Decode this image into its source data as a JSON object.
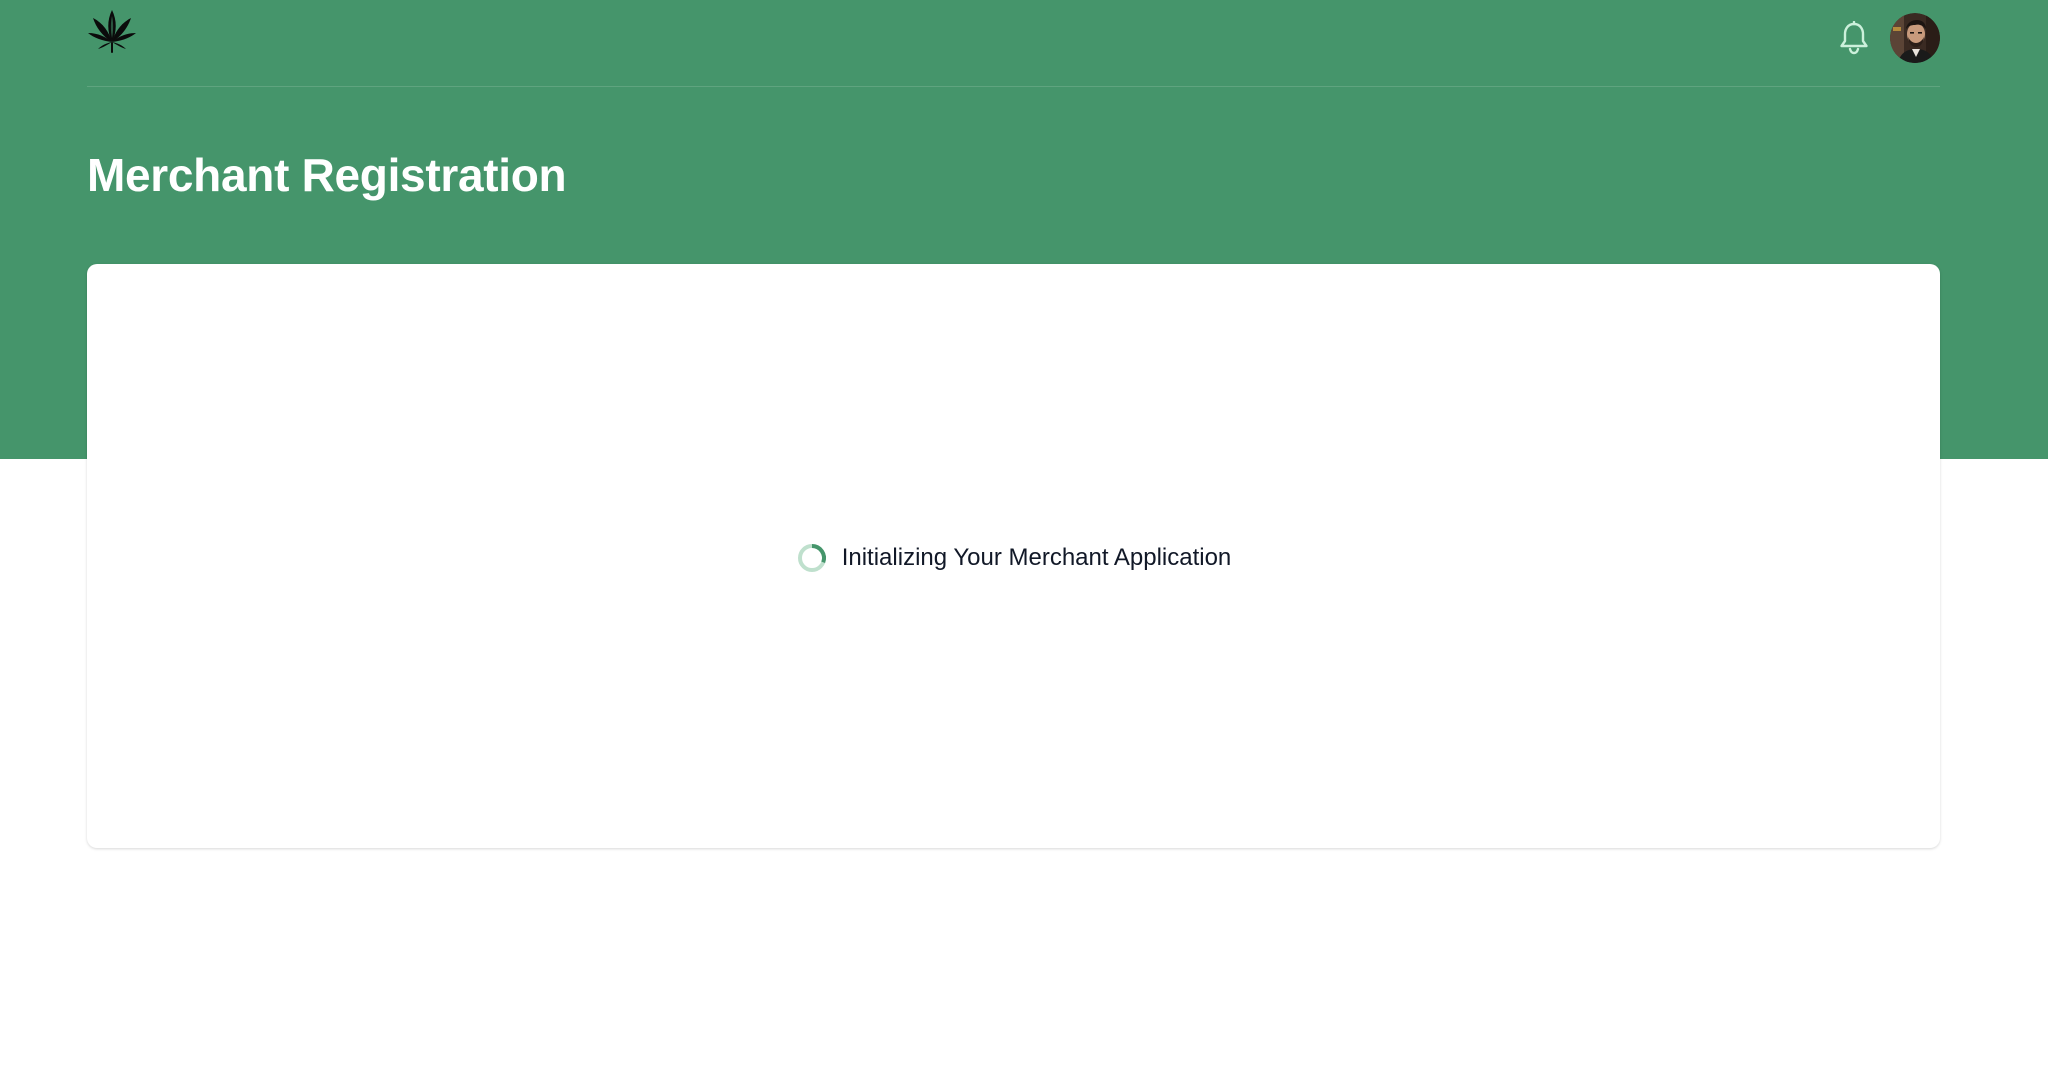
{
  "header": {
    "logo_icon": "cannabis-leaf-icon",
    "notification_icon": "bell-icon",
    "avatar": "user-avatar-photo"
  },
  "page": {
    "title": "Merchant Registration"
  },
  "card": {
    "loading_icon": "spinner-icon",
    "loading_text": "Initializing Your Merchant Application"
  },
  "colors": {
    "brand_green": "#45956b",
    "spinner_track": "#bfe0cd",
    "spinner_arc": "#45956b",
    "text_dark": "#111827",
    "background": "#ffffff"
  }
}
